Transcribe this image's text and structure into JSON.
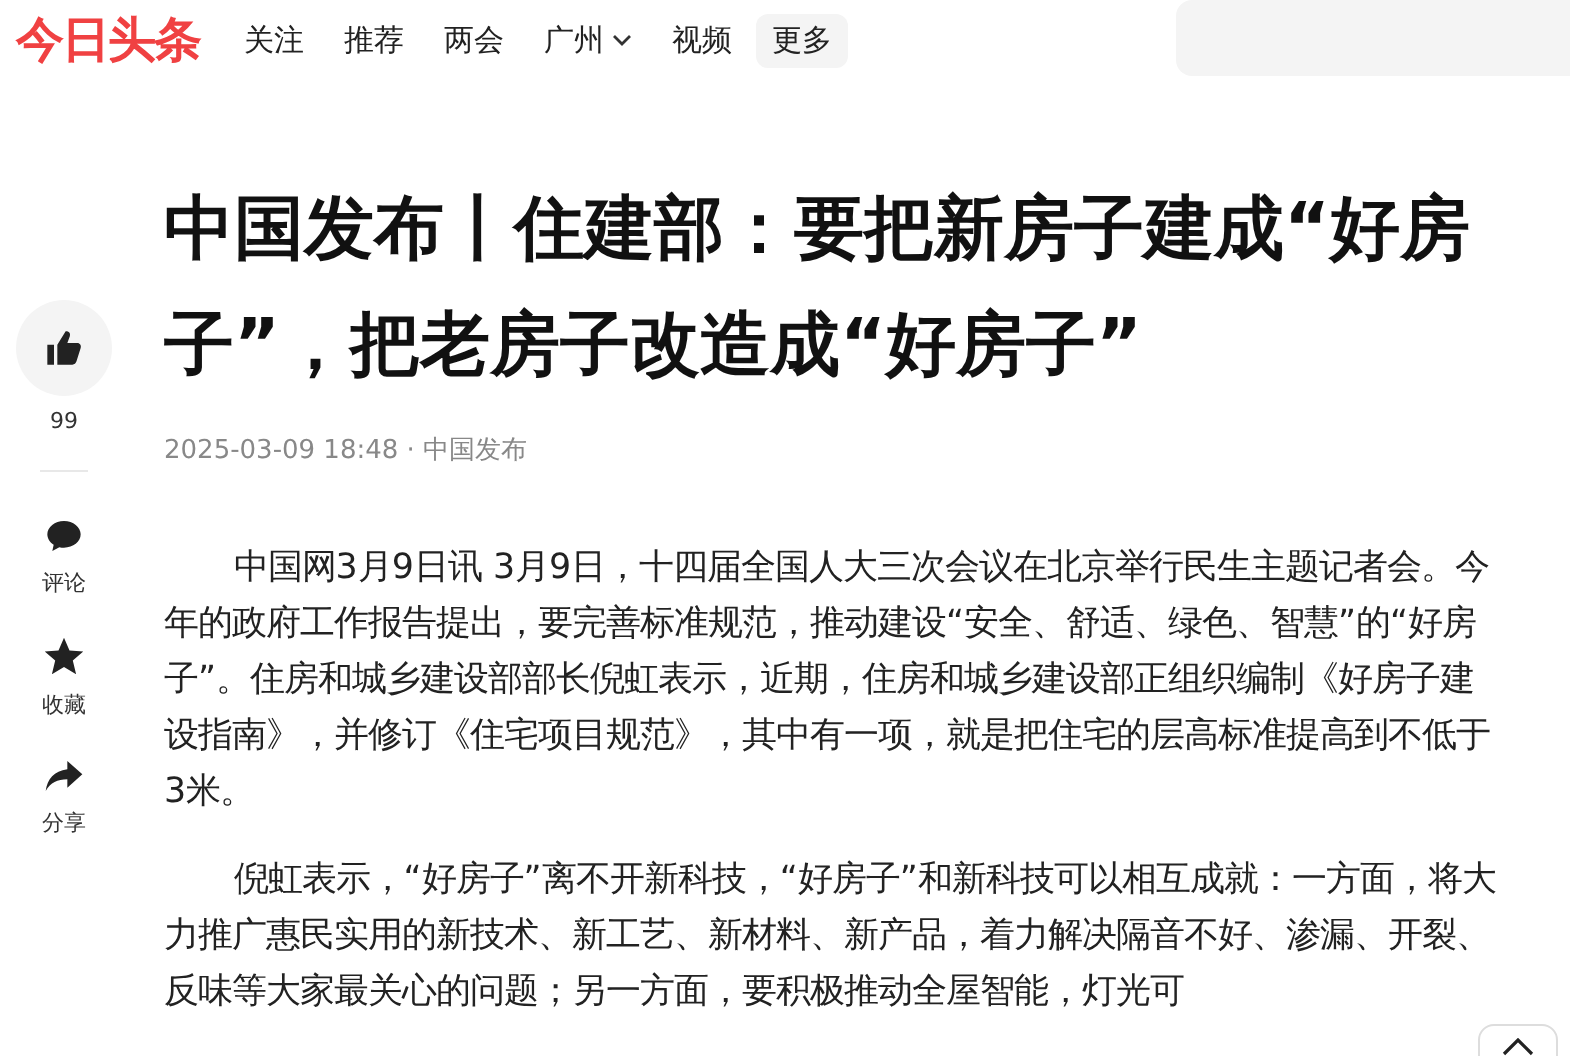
{
  "header": {
    "logo": "今日头条",
    "nav": [
      {
        "label": "关注",
        "kind": "link"
      },
      {
        "label": "推荐",
        "kind": "link"
      },
      {
        "label": "两会",
        "kind": "link"
      },
      {
        "label": "广州",
        "kind": "dropdown"
      },
      {
        "label": "视频",
        "kind": "link"
      },
      {
        "label": "更多",
        "kind": "more"
      }
    ]
  },
  "sidebar": {
    "actions": [
      {
        "kind": "like",
        "label": "99"
      },
      {
        "kind": "comment",
        "label": "评论"
      },
      {
        "kind": "favorite",
        "label": "收藏"
      },
      {
        "kind": "share",
        "label": "分享"
      }
    ]
  },
  "article": {
    "title": "中国发布丨住建部：要把新房子建成“好房子”，把老房子改造成“好房子”",
    "meta": "2025-03-09 18:48 · 中国发布",
    "paragraphs": [
      "中国网3月9日讯 3月9日，十四届全国人大三次会议在北京举行民生主题记者会。今年的政府工作报告提出，要完善标准规范，推动建设“安全、舒适、绿色、智慧”的“好房子”。住房和城乡建设部部长倪虹表示，近期，住房和城乡建设部正组织编制《好房子建设指南》，并修订《住宅项目规范》，其中有一项，就是把住宅的层高标准提高到不低于3米。",
      "倪虹表示，“好房子”离不开新科技，“好房子”和新科技可以相互成就：一方面，将大力推广惠民实用的新技术、新工艺、新材料、新产品，着力解决隔音不好、渗漏、开裂、反味等大家最关心的问题；另一方面，要积极推动全屋智能，灯光可"
    ]
  }
}
